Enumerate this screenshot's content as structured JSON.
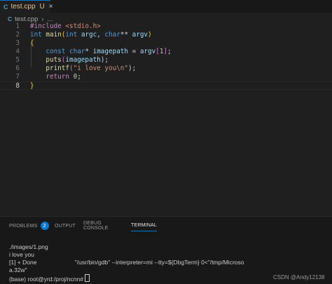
{
  "tab": {
    "icon": "C",
    "filename": "test.cpp",
    "status": "U",
    "close": "×"
  },
  "breadcrumb": {
    "icon": "C",
    "filename": "test.cpp",
    "separator": "›",
    "more": "..."
  },
  "editor": {
    "line_numbers": [
      "1",
      "2",
      "3",
      "4",
      "5",
      "6",
      "7",
      "8"
    ],
    "active_line": "8",
    "code": {
      "l1": {
        "directive": "#include",
        "header": "<stdio.h>"
      },
      "l2": {
        "ret_type": "int",
        "func": "main",
        "open": "(",
        "t1": "int",
        "p1": "argc",
        "comma": ",",
        "t2": "char",
        "stars": "**",
        "p2": "argv",
        "close": ")"
      },
      "l3": {
        "brace": "{"
      },
      "l4": {
        "q": "const",
        "t": "char",
        "star": "*",
        "v": "imagepath",
        "eq": "=",
        "arr": "argv",
        "lb": "[",
        "idx": "1",
        "rb": "]",
        "semi": ";"
      },
      "l5": {
        "fn": "puts",
        "open": "(",
        "arg": "imagepath",
        "close": ");"
      },
      "l6": {
        "fn": "printf",
        "open": "(",
        "str": "\"i love you\\n\"",
        "close": ");"
      },
      "l7": {
        "kw": "return",
        "num": "0",
        "semi": ";"
      },
      "l8": {
        "brace": "}"
      }
    }
  },
  "panel": {
    "tabs": [
      {
        "label": "PROBLEMS",
        "badge": "2"
      },
      {
        "label": "OUTPUT"
      },
      {
        "label": "DEBUG CONSOLE"
      },
      {
        "label": "TERMINAL"
      }
    ],
    "active_tab": "TERMINAL",
    "terminal_lines": [
      "./images/1.png",
      "i love you",
      "[1] + Done                       \"/usr/bin/gdb\" --interpreter=mi --tty=${DbgTerm} 0<\"/tmp/Microso",
      "a.32w\""
    ],
    "prompt": "(base) root@yrd:/proj/ncnn# "
  },
  "watermark": "CSDN @Andy12138",
  "colors": {
    "accent": "#0078d4",
    "editor_bg": "#1f1f1f",
    "panel_bg": "#181818"
  }
}
